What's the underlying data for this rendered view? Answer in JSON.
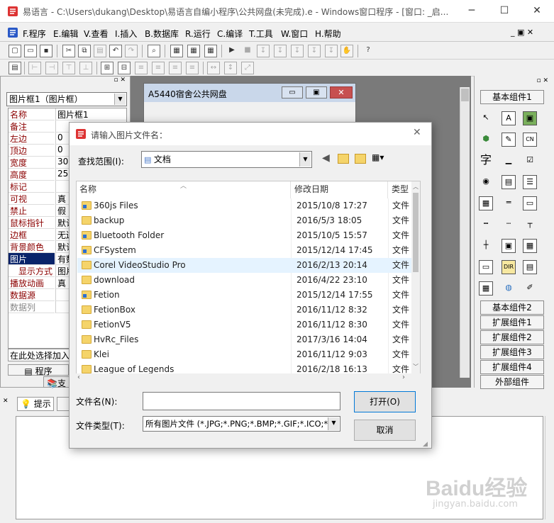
{
  "window": {
    "title": "易语言 - C:\\Users\\dukang\\Desktop\\易语言自编小程序\\公共网盘(未完成).e - Windows窗口程序 - [窗口: _启...",
    "min": "─",
    "max": "☐",
    "close": "✕"
  },
  "menu": [
    "F.程序",
    "E.编辑",
    "V.查看",
    "I.插入",
    "B.数据库",
    "R.运行",
    "C.编译",
    "T.工具",
    "W.窗口",
    "H.帮助"
  ],
  "left": {
    "object_combo": "图片框1（图片框）",
    "props": [
      {
        "k": "名称",
        "v": "图片框1"
      },
      {
        "k": "备注",
        "v": ""
      },
      {
        "k": "左边",
        "v": "0"
      },
      {
        "k": "顶边",
        "v": "0"
      },
      {
        "k": "宽度",
        "v": "300"
      },
      {
        "k": "高度",
        "v": "250"
      },
      {
        "k": "标记",
        "v": ""
      },
      {
        "k": "可视",
        "v": "真"
      },
      {
        "k": "禁止",
        "v": "假"
      },
      {
        "k": "鼠标指针",
        "v": "默认"
      },
      {
        "k": "边框",
        "v": "无边"
      },
      {
        "k": "背景颜色",
        "v": "默认"
      },
      {
        "k": "图片",
        "v": "有数"
      },
      {
        "k": "显示方式",
        "v": "图片"
      },
      {
        "k": "播放动画",
        "v": "真"
      },
      {
        "k": "数据源",
        "v": ""
      },
      {
        "k": "数据列",
        "v": ""
      }
    ],
    "hint": "在此处选择加入",
    "tab1": "程序",
    "tab2": "支"
  },
  "designer": {
    "window_title": "A5440宿舍公共网盘"
  },
  "right": {
    "basic_top": "基本组件1",
    "buttons": [
      "基本组件2",
      "扩展组件1",
      "扩展组件2",
      "扩展组件3",
      "扩展组件4",
      "外部组件"
    ],
    "icons": [
      "arrow-icon",
      "label-icon",
      "picture-icon",
      "shape-icon",
      "draw-icon",
      "cn-icon",
      "char-icon",
      "line-icon",
      "check-icon",
      "radio-icon",
      "combo-icon",
      "list-icon",
      "grid-icon",
      "slider-icon",
      "progress-icon",
      "ruler-icon",
      "tick-icon",
      "tree-icon",
      "window-icon",
      "image-icon",
      "table-icon",
      "edit-icon",
      "dir-icon",
      "doc-icon",
      "calendar-icon",
      "globe-icon",
      "pen-icon"
    ]
  },
  "bottom": {
    "tab_hint": "提示"
  },
  "dialog": {
    "title": "请输入图片文件名：",
    "lookin_label": "查找范围(I):",
    "lookin_value": "文档",
    "col_name": "名称",
    "col_date": "修改日期",
    "col_type": "类型",
    "files": [
      {
        "name": "360js Files",
        "date": "2015/10/8 17:27",
        "type": "文件",
        "special": true
      },
      {
        "name": "backup",
        "date": "2016/5/3 18:05",
        "type": "文件",
        "special": false
      },
      {
        "name": "Bluetooth Folder",
        "date": "2015/10/5 15:57",
        "type": "文件",
        "special": true
      },
      {
        "name": "CFSystem",
        "date": "2015/12/14 17:45",
        "type": "文件",
        "special": true
      },
      {
        "name": "Corel VideoStudio Pro",
        "date": "2016/2/13 20:14",
        "type": "文件",
        "special": false
      },
      {
        "name": "download",
        "date": "2016/4/22 23:10",
        "type": "文件",
        "special": false
      },
      {
        "name": "Fetion",
        "date": "2015/12/14 17:55",
        "type": "文件",
        "special": true
      },
      {
        "name": "FetionBox",
        "date": "2016/11/12 8:32",
        "type": "文件",
        "special": false
      },
      {
        "name": "FetionV5",
        "date": "2016/11/12 8:30",
        "type": "文件",
        "special": false
      },
      {
        "name": "HvRc_Files",
        "date": "2017/3/16 14:04",
        "type": "文件",
        "special": false
      },
      {
        "name": "Klei",
        "date": "2016/11/12 9:03",
        "type": "文件",
        "special": false
      },
      {
        "name": "League of Legends",
        "date": "2016/2/18 16:13",
        "type": "文件",
        "special": false
      }
    ],
    "filename_label": "文件名(N):",
    "filename_value": "",
    "filetype_label": "文件类型(T):",
    "filetype_value": "所有图片文件 (*.JPG;*.PNG;*.BMP;*.GIF;*.ICO;*",
    "open": "打开(O)",
    "cancel": "取消"
  },
  "watermark": {
    "brand": "Baidu经验",
    "url": "jingyan.baidu.com"
  }
}
